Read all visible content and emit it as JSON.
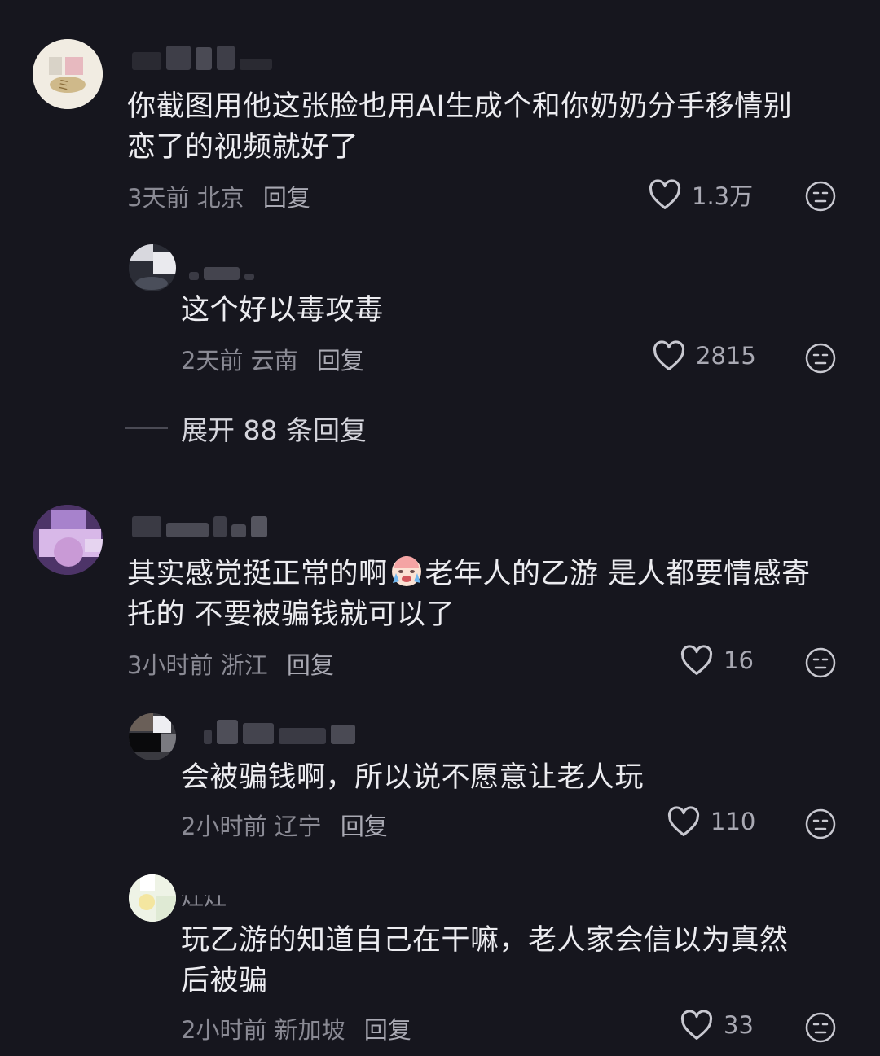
{
  "comments": [
    {
      "text_lines": [
        "你截图用他这张脸也用AI生成个和你奶奶分手移情别",
        "恋了的视频就好了"
      ],
      "time": "3天前",
      "location": "北京",
      "reply_label": "回复",
      "likes": "1.3万"
    },
    {
      "text_lines": [
        "这个好以毒攻毒"
      ],
      "time": "2天前",
      "location": "云南",
      "reply_label": "回复",
      "likes": "2815"
    },
    {
      "expand_label": "展开 88 条回复"
    },
    {
      "text_line1_a": "其实感觉挺正常的啊",
      "text_line1_b": "老年人的乙游 是人都要情感寄",
      "text_line2": "托的 不要被骗钱就可以了",
      "time": "3小时前",
      "location": "浙江",
      "reply_label": "回复",
      "likes": "16"
    },
    {
      "text_lines": [
        "会被骗钱啊，所以说不愿意让老人玩"
      ],
      "time": "2小时前",
      "location": "辽宁",
      "reply_label": "回复",
      "likes": "110"
    },
    {
      "username_partial": "灶灶",
      "text_lines": [
        "玩乙游的知道自己在干嘛，老人家会信以为真然",
        "后被骗"
      ],
      "time": "2小时前",
      "location": "新加坡",
      "reply_label": "回复",
      "likes": "33"
    }
  ],
  "icons": {
    "like": "heart-outline-icon",
    "dislike": "meh-face-icon",
    "emoji": "crying-face-emoji"
  },
  "colors": {
    "background": "#16161e",
    "text": "#ececf0",
    "meta": "#8a8a94"
  }
}
